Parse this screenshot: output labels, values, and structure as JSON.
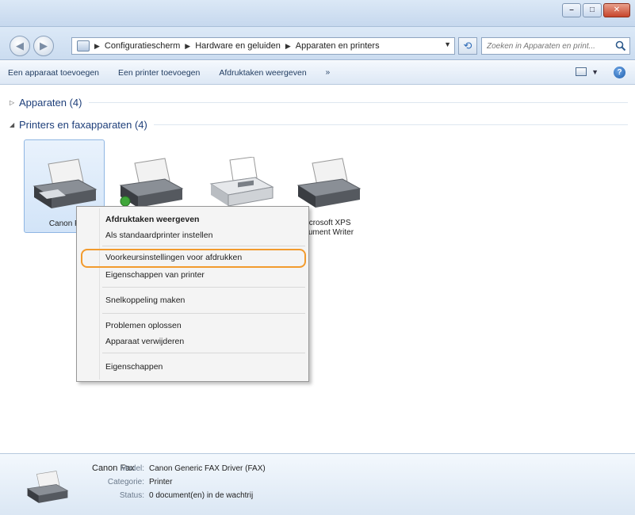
{
  "breadcrumbs": [
    "Configuratiescherm",
    "Hardware en geluiden",
    "Apparaten en printers"
  ],
  "search": {
    "placeholder": "Zoeken in Apparaten en print..."
  },
  "commands": [
    "Een apparaat toevoegen",
    "Een printer toevoegen",
    "Afdruktaken weergeven",
    "»"
  ],
  "groups": {
    "devices_label": "Apparaten (4)",
    "printers_label": "Printers en faxapparaten (4)"
  },
  "devices": [
    {
      "name": "Canon F"
    },
    {
      "name": ""
    },
    {
      "name": ""
    },
    {
      "name_line1": "icrosoft XPS",
      "name_line2": "cument Writer"
    }
  ],
  "context_menu": {
    "items": [
      "Afdruktaken weergeven",
      "Als standaardprinter instellen",
      "Voorkeursinstellingen voor afdrukken",
      "Eigenschappen van printer",
      "Snelkoppeling maken",
      "Problemen oplossen",
      "Apparaat verwijderen",
      "Eigenschappen"
    ],
    "highlighted": "Voorkeursinstellingen voor afdrukken"
  },
  "details": {
    "name": "Canon Fax",
    "model_label": "Model:",
    "model": "Canon Generic FAX Driver (FAX)",
    "category_label": "Categorie:",
    "category": "Printer",
    "status_label": "Status:",
    "status": "0 document(en) in de wachtrij"
  },
  "colors": {
    "highlight": "#f29b2e",
    "group_label": "#1e3f7a",
    "selection": "#d2e4f8"
  }
}
